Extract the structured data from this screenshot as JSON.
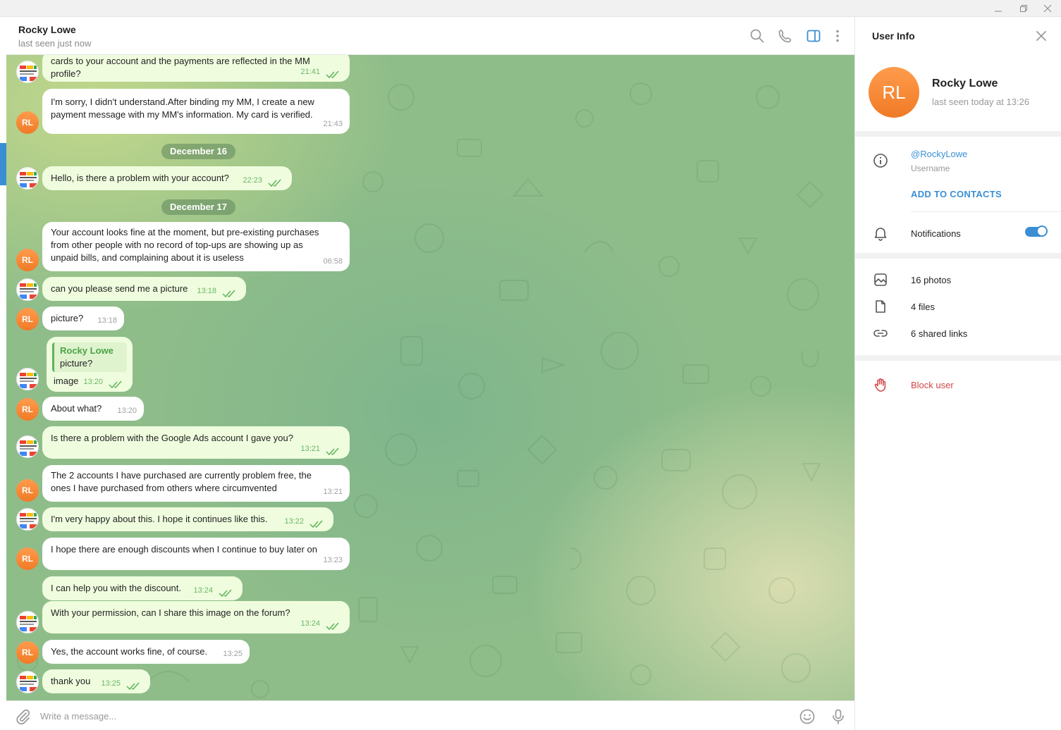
{
  "window": {
    "minimize_icon": "minimize-icon",
    "restore_icon": "restore-icon",
    "close_icon": "close-icon"
  },
  "header": {
    "title": "Rocky Lowe",
    "status": "last seen just now"
  },
  "colors": {
    "accent": "#3a8fd4",
    "outgoing_bubble": "#effdde",
    "incoming_bubble": "#ffffff",
    "avatar_orange": "#f38a35",
    "danger": "#d14646"
  },
  "avatars": {
    "contact_initials": "RL",
    "me_logo": "google-services-logo"
  },
  "messages": [
    {
      "id": "m1",
      "side": "out",
      "text": "cards to your account and the payments are reflected in the MM\nprofile?",
      "time": "21:41"
    },
    {
      "id": "m2",
      "side": "in",
      "text": "I'm sorry, I didn't understand.After binding my MM, I create a new\npayment message with my MM's information. My card is verified.",
      "time": "21:43"
    },
    {
      "id": "d1",
      "type": "date",
      "text": "December 16"
    },
    {
      "id": "m3",
      "side": "out",
      "text": "Hello, is there a problem with your account?",
      "time": "22:23"
    },
    {
      "id": "d2",
      "type": "date",
      "text": "December 17"
    },
    {
      "id": "m4",
      "side": "in",
      "text": "Your account looks fine at the moment, but pre-existing purchases\nfrom other people with no record of top-ups are showing up as\nunpaid bills, and complaining about it is useless",
      "time": "06:58"
    },
    {
      "id": "m5",
      "side": "out",
      "text": "can you please send me a picture",
      "time": "13:18"
    },
    {
      "id": "m6",
      "side": "in",
      "text": "picture?",
      "time": "13:18"
    },
    {
      "id": "m7",
      "side": "out",
      "reply_name": "Rocky Lowe",
      "reply_text": "picture?",
      "text": "image",
      "time": "13:20"
    },
    {
      "id": "m8",
      "side": "in",
      "text": "About what?",
      "time": "13:20"
    },
    {
      "id": "m9",
      "side": "out",
      "text": "Is there a problem with the Google Ads account I gave you?",
      "time": "13:21"
    },
    {
      "id": "m10",
      "side": "in",
      "text": "The 2 accounts I have purchased are currently problem free, the\nones I have purchased from others where circumvented",
      "time": "13:21"
    },
    {
      "id": "m11",
      "side": "out",
      "text": "I'm very happy about this. I hope it continues like this.",
      "time": "13:22"
    },
    {
      "id": "m12",
      "side": "in",
      "text": "I hope there are enough discounts when I continue to buy later on",
      "time": "13:23"
    },
    {
      "id": "m13",
      "side": "out",
      "text": "I can help you with the discount.",
      "time": "13:24"
    },
    {
      "id": "m14",
      "side": "out",
      "text": "With your permission, can I share this image on the forum?",
      "time": "13:24"
    },
    {
      "id": "m15",
      "side": "in",
      "text": "Yes, the account works fine, of course.",
      "time": "13:25"
    },
    {
      "id": "m16",
      "side": "out",
      "text": "thank you",
      "time": "13:25"
    }
  ],
  "composer": {
    "placeholder": "Write a message..."
  },
  "panel": {
    "title": "User Info",
    "name": "Rocky Lowe",
    "initials": "RL",
    "status": "last seen today at 13:26",
    "username": "@RockyLowe",
    "username_label": "Username",
    "add_contacts": "ADD TO CONTACTS",
    "notifications": "Notifications",
    "notifications_on": true,
    "photos": "16 photos",
    "files": "4 files",
    "links": "6 shared links",
    "block": "Block user"
  }
}
